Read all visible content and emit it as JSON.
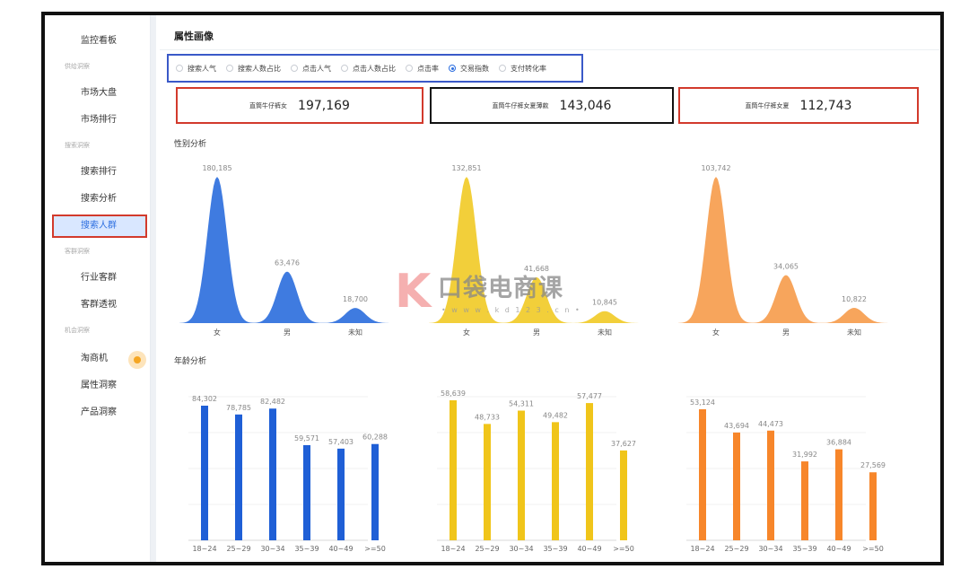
{
  "sidebar": {
    "items": [
      {
        "label": "监控看板",
        "type": "item"
      },
      {
        "label": "供给洞察",
        "type": "group"
      },
      {
        "label": "市场大盘",
        "type": "item"
      },
      {
        "label": "市场排行",
        "type": "item"
      },
      {
        "label": "搜索洞察",
        "type": "group"
      },
      {
        "label": "搜索排行",
        "type": "item"
      },
      {
        "label": "搜索分析",
        "type": "item"
      },
      {
        "label": "搜索人群",
        "type": "item",
        "active": true
      },
      {
        "label": "客群洞察",
        "type": "group"
      },
      {
        "label": "行业客群",
        "type": "item"
      },
      {
        "label": "客群透视",
        "type": "item"
      },
      {
        "label": "机会洞察",
        "type": "group"
      },
      {
        "label": "淘商机",
        "type": "item",
        "badge": true
      },
      {
        "label": "属性洞察",
        "type": "item"
      },
      {
        "label": "产品洞察",
        "type": "item"
      }
    ]
  },
  "page_title": "属性画像",
  "metrics": {
    "options": [
      "搜索人气",
      "搜索人数占比",
      "点击人气",
      "点击人数占比",
      "点击率",
      "交易指数",
      "支付转化率"
    ],
    "selected": "交易指数"
  },
  "stats": [
    {
      "label": "直筒牛仔裤女",
      "value": "197,169",
      "border": "#d23a2c"
    },
    {
      "label": "直筒牛仔裤女夏薄款",
      "value": "143,046",
      "border": "#111111"
    },
    {
      "label": "直筒牛仔裤女夏",
      "value": "112,743",
      "border": "#d23a2c"
    }
  ],
  "sections": {
    "gender": "性别分析",
    "age": "年龄分析"
  },
  "colors": {
    "blue": "#3f7be0",
    "yellow": "#f2cf3a",
    "orange": "#f7a55c",
    "bar_blue": "#1f5fd6",
    "bar_yellow": "#f0c51a",
    "bar_orange": "#f7862a"
  },
  "chart_data": [
    {
      "type": "area",
      "categories": [
        "女",
        "男",
        "未知"
      ],
      "values": [
        180185,
        63476,
        18700
      ]
    },
    {
      "type": "area",
      "categories": [
        "女",
        "男",
        "未知"
      ],
      "values": [
        132851,
        41668,
        10845
      ]
    },
    {
      "type": "area",
      "categories": [
        "女",
        "男",
        "未知"
      ],
      "values": [
        103742,
        34065,
        10822
      ]
    },
    {
      "type": "bar",
      "categories": [
        "18~24",
        "25~29",
        "30~34",
        "35~39",
        "40~49",
        ">=50"
      ],
      "values": [
        84302,
        78785,
        82482,
        59571,
        57403,
        60288
      ]
    },
    {
      "type": "bar",
      "categories": [
        "18~24",
        "25~29",
        "30~34",
        "35~39",
        "40~49",
        ">=50"
      ],
      "values": [
        58639,
        48733,
        54311,
        49482,
        57477,
        37627
      ]
    },
    {
      "type": "bar",
      "categories": [
        "18~24",
        "25~29",
        "30~34",
        "35~39",
        "40~49",
        ">=50"
      ],
      "values": [
        53124,
        43694,
        44473,
        31992,
        36884,
        27569
      ]
    }
  ],
  "watermark": {
    "logo": "K",
    "brand": "口袋电商课",
    "url": "• w w w . k d 1 2 3 . c n •"
  }
}
